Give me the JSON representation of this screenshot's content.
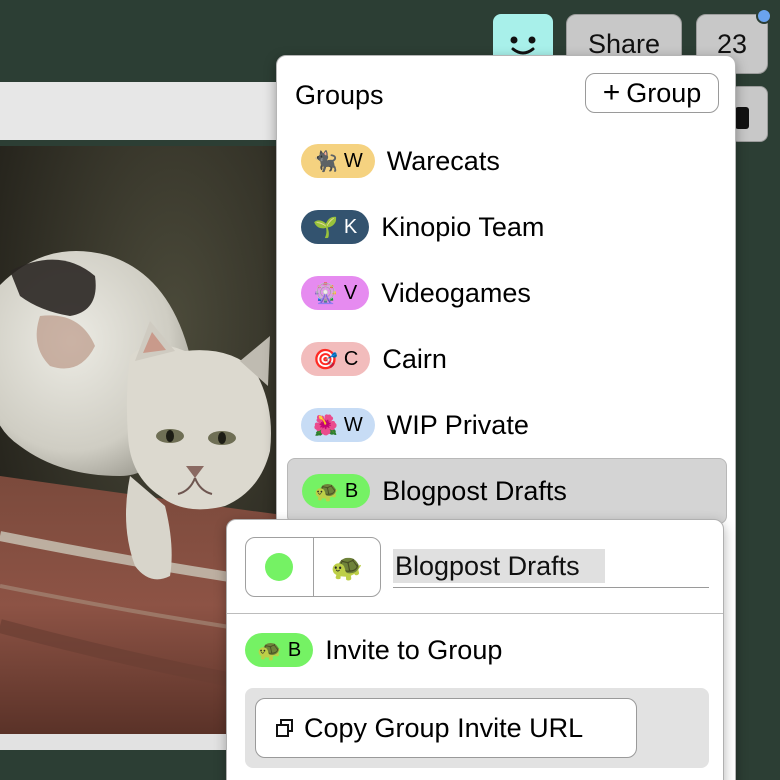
{
  "header": {
    "share_label": "Share",
    "count_label": "23"
  },
  "groups_dialog": {
    "title": "Groups",
    "add_group_label": "Group",
    "groups": [
      {
        "emoji": "🐈‍⬛",
        "letter": "W",
        "name": "Warecats",
        "color": "#f5d280",
        "letter_color": "#222"
      },
      {
        "emoji": "🌱",
        "letter": "K",
        "name": "Kinopio Team",
        "color": "#33536f",
        "letter_color": "#fff"
      },
      {
        "emoji": "🎡",
        "letter": "V",
        "name": "Videogames",
        "color": "#e68bf0",
        "letter_color": "#222"
      },
      {
        "emoji": "🎯",
        "letter": "C",
        "name": "Cairn",
        "color": "#f2bcbc",
        "letter_color": "#222"
      },
      {
        "emoji": "🌺",
        "letter": "W",
        "name": "WIP Private",
        "color": "#c7dcf5",
        "letter_color": "#222"
      },
      {
        "emoji": "🐢",
        "letter": "B",
        "name": "Blogpost Drafts",
        "color": "#75f264",
        "letter_color": "#222"
      }
    ]
  },
  "group_details": {
    "color": "#75f264",
    "emoji": "🐢",
    "name_value": "Blogpost Drafts",
    "invite_badge": {
      "emoji": "🐢",
      "letter": "B"
    },
    "invite_label": "Invite to Group",
    "copy_url_label": "Copy Group Invite URL"
  },
  "icons": {
    "avatar": "smiley-face-icon",
    "copy": "copy-icon",
    "plus": "plus-icon"
  }
}
